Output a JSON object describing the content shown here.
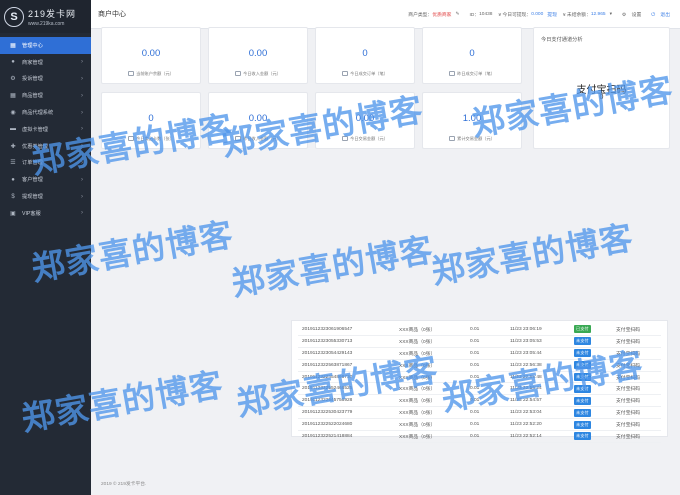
{
  "logo": {
    "badge": "S",
    "title": "219发卡网",
    "subtitle": "www.219ka.com"
  },
  "sidebar": {
    "items": [
      {
        "label": "管理中心",
        "icon": "▦",
        "active": true,
        "arrow": ""
      },
      {
        "label": "商家管理",
        "icon": "●",
        "active": false,
        "arrow": "›"
      },
      {
        "label": "投诉管理",
        "icon": "⚙",
        "active": false,
        "arrow": "›"
      },
      {
        "label": "商品管理",
        "icon": "▦",
        "active": false,
        "arrow": "›"
      },
      {
        "label": "商品代理系统",
        "icon": "◉",
        "active": false,
        "arrow": "›"
      },
      {
        "label": "虚拟卡管理",
        "icon": "▬",
        "active": false,
        "arrow": "›"
      },
      {
        "label": "优惠券管理",
        "icon": "✚",
        "active": false,
        "arrow": "›"
      },
      {
        "label": "订单管理",
        "icon": "☰",
        "active": false,
        "arrow": "›"
      },
      {
        "label": "客户管理",
        "icon": "●",
        "active": false,
        "arrow": "›"
      },
      {
        "label": "提现管理",
        "icon": "$",
        "active": false,
        "arrow": "›"
      },
      {
        "label": "VIP客服",
        "icon": "▣",
        "active": false,
        "arrow": "›"
      }
    ]
  },
  "header": {
    "title": "商户中心",
    "account_type_label": "商户类型：",
    "account_type_value": "优质商家",
    "id_label": "ID：",
    "id_value": "10438",
    "withdraw_label": "¥ 今日可提现：",
    "withdraw_value": "0.000",
    "withdraw_link": "提现",
    "balance_label": "¥ 未结余额：",
    "balance_value": "12.965",
    "settings_label": "设置",
    "logout_label": "退出"
  },
  "stats": [
    {
      "value": "0.00",
      "label": "当前账户余额（元）"
    },
    {
      "value": "0.00",
      "label": "今日收入金额（元）"
    },
    {
      "value": "0",
      "label": "今日成交订单（笔）"
    },
    {
      "value": "0",
      "label": "昨日成交订单（笔）"
    },
    {
      "value": "0",
      "label": "今日卖出卡数（张）"
    },
    {
      "value": "0.00",
      "label": "昨日收入金额（元）"
    },
    {
      "value": "0.00",
      "label": "今日交易金额（元）"
    },
    {
      "value": "1.00",
      "label": "累计交易金额（元）"
    }
  ],
  "analysis": {
    "title": "今日支付通道分析",
    "channel": "支付宝扫码",
    "value": "0"
  },
  "orders": [
    {
      "no": "2019112323061906547",
      "name": "XXX商品（0张）",
      "amount": "0.01",
      "time": "11/23 23:06:19",
      "status": "已支付",
      "paid": true,
      "pay": "支付宝扫码"
    },
    {
      "no": "2019112323055330713",
      "name": "XXX商品（0张）",
      "amount": "0.01",
      "time": "11/23 23:05:53",
      "status": "未支付",
      "paid": false,
      "pay": "支付宝扫码"
    },
    {
      "no": "2019112323054429143",
      "name": "XXX商品（0张）",
      "amount": "0.01",
      "time": "11/23 23:05:44",
      "status": "未支付",
      "paid": false,
      "pay": "支付宝扫码"
    },
    {
      "no": "2019112322563871867",
      "name": "XXX商品（0张）",
      "amount": "0.01",
      "time": "11/23 22:56:38",
      "status": "未支付",
      "paid": false,
      "pay": "支付宝扫码"
    },
    {
      "no": "2019112322554868730",
      "name": "XXX商品（0张）",
      "amount": "0.01",
      "time": "11/23 22:55:48",
      "status": "未支付",
      "paid": false,
      "pay": "支付宝扫码"
    },
    {
      "no": "2019112322552468525",
      "name": "XXX商品（0张）",
      "amount": "0.01",
      "time": "11/23 22:55:24",
      "status": "未支付",
      "paid": false,
      "pay": "支付宝扫码"
    },
    {
      "no": "2019112322545756928",
      "name": "XXX商品（0张）",
      "amount": "0.01",
      "time": "11/23 22:54:57",
      "status": "未支付",
      "paid": false,
      "pay": "支付宝扫码"
    },
    {
      "no": "2019112322530423779",
      "name": "XXX商品（0张）",
      "amount": "0.01",
      "time": "11/23 22:53:04",
      "status": "未支付",
      "paid": false,
      "pay": "支付宝扫码"
    },
    {
      "no": "2019112322522024680",
      "name": "XXX商品（0张）",
      "amount": "0.01",
      "time": "11/23 22:52:20",
      "status": "未支付",
      "paid": false,
      "pay": "支付宝扫码"
    },
    {
      "no": "2019112322521418884",
      "name": "XXX商品（0张）",
      "amount": "0.01",
      "time": "11/23 22:52:14",
      "status": "未支付",
      "paid": false,
      "pay": "支付宝扫码"
    }
  ],
  "footer": "2019 © 219发卡平台.",
  "watermark": "郑家喜的博客"
}
